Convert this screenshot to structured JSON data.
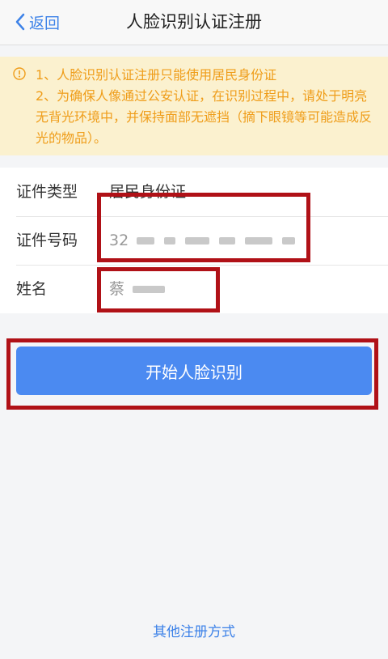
{
  "nav": {
    "back_label": "返回",
    "title": "人脸识别认证注册"
  },
  "notice": {
    "line1": "1、人脸识别认证注册只能使用居民身份证",
    "line2": "2、为确保人像通过公安认证，在识别过程中，请处于明亮无背光环境中，并保持面部无遮挡（摘下眼镜等可能造成反光的物品）。",
    "icon": "warning-circle-icon",
    "color": "#ef9d1a"
  },
  "form": {
    "id_type_label": "证件类型",
    "id_type_value": "居民身份证",
    "id_number_label": "证件号码",
    "id_number_visible_prefix": "32",
    "name_label": "姓名",
    "name_visible_prefix": "蔡"
  },
  "actions": {
    "start_label": "开始人脸识别",
    "other_label": "其他注册方式"
  },
  "colors": {
    "accent": "#4b8af1",
    "link": "#3d82e8",
    "annotation_red": "#b01117"
  }
}
